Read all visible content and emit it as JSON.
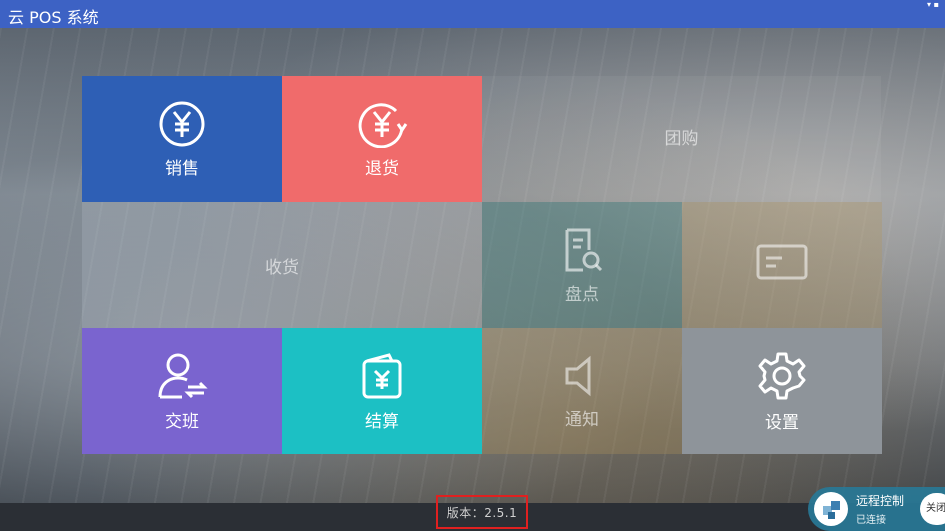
{
  "app": {
    "title": "云 POS 系统"
  },
  "tiles": {
    "sale": {
      "label": "销售",
      "icon": "yen-circle-icon",
      "color": "#2e5fb5"
    },
    "refund": {
      "label": "退货",
      "icon": "yen-refund-icon",
      "color": "#f06b6b"
    },
    "group_buy": {
      "label": "团购",
      "icon": "none"
    },
    "receive": {
      "label": "收货",
      "icon": "none"
    },
    "inventory": {
      "label": "盘点",
      "icon": "document-search-icon"
    },
    "card": {
      "label": "",
      "icon": "card-icon"
    },
    "handover": {
      "label": "交班",
      "icon": "user-switch-icon",
      "color": "#7a64cf"
    },
    "checkout": {
      "label": "结算",
      "icon": "wallet-yen-icon",
      "color": "#1cc0c4"
    },
    "notice": {
      "label": "通知",
      "icon": "speaker-icon"
    },
    "settings": {
      "label": "设置",
      "icon": "gear-icon",
      "color": "#8e949a"
    }
  },
  "footer": {
    "version": "版本：2.5.1"
  },
  "remote": {
    "title": "远程控制",
    "status": "已连接",
    "close_label": "关闭"
  }
}
